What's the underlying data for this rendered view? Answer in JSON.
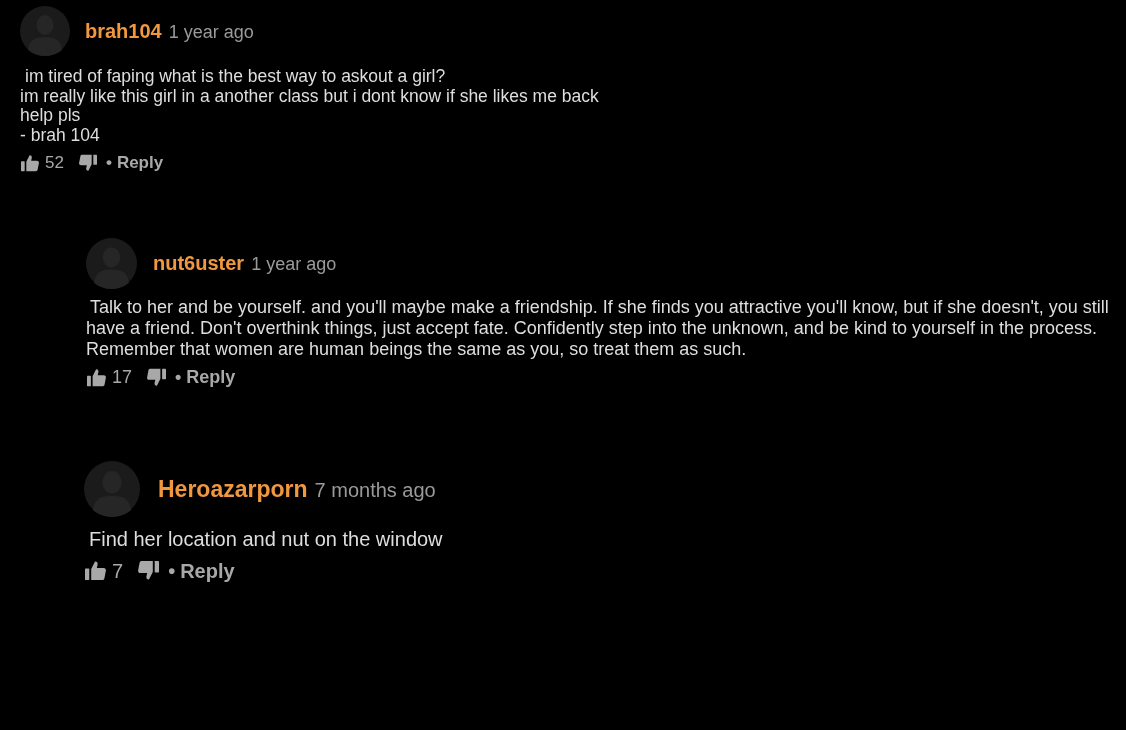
{
  "comments": [
    {
      "author": "brah104",
      "time": "1 year ago",
      "body": "im tired of faping what is the best way to askout a girl?\nim really like this girl in a another class but i dont know if she likes me back\nhelp pls\n- brah 104",
      "likes": "52",
      "separator": "•",
      "reply": "Reply",
      "children": [
        {
          "author": "nut6uster",
          "time": "1 year ago",
          "body": "Talk to her and be yourself. and you'll maybe make a friendship. If she finds you attractive you'll know, but if she doesn't, you still have a friend. Don't overthink things, just accept fate. Confidently step into the unknown, and be kind to yourself in the process. Remember that women are human beings the same as you, so treat them as such.",
          "likes": "17",
          "separator": "•",
          "reply": "Reply"
        },
        {
          "author": "Heroazarporn",
          "time": "7 months ago",
          "body": "Find her location and nut on the window",
          "likes": "7",
          "separator": "•",
          "reply": "Reply"
        }
      ]
    }
  ]
}
